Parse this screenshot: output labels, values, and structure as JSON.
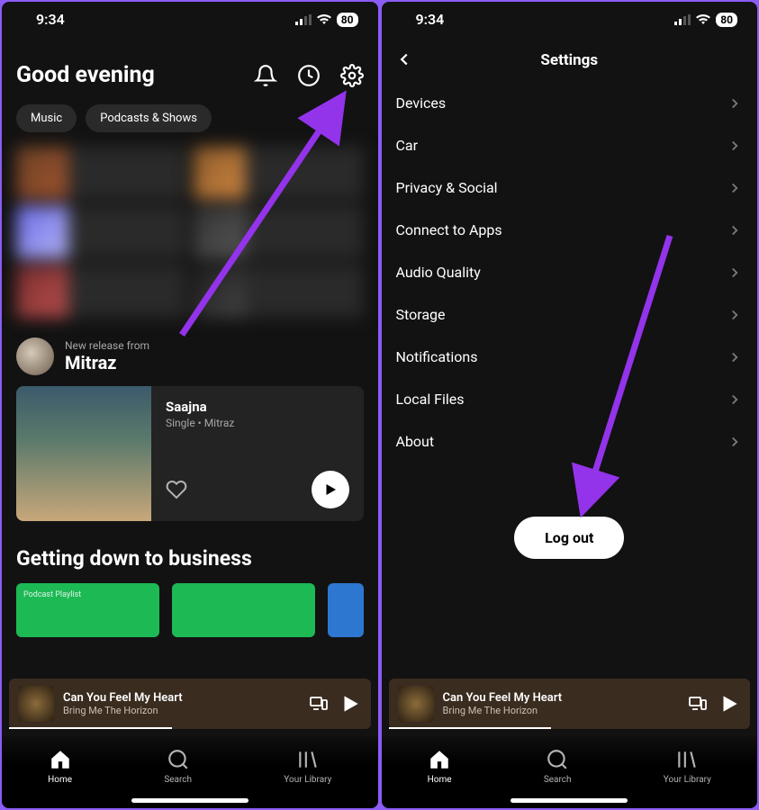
{
  "status": {
    "time": "9:34",
    "battery": "80"
  },
  "home": {
    "greeting": "Good evening",
    "chips": [
      "Music",
      "Podcasts & Shows"
    ],
    "release": {
      "label": "New release from",
      "artist": "Mitraz",
      "track": "Saajna",
      "meta": "Single • Mitraz"
    },
    "section2": "Getting down to business",
    "podcast_badge": "Podcast Playlist"
  },
  "nowplaying": {
    "title": "Can You Feel My Heart",
    "artist": "Bring Me The Horizon"
  },
  "nav": {
    "home": "Home",
    "search": "Search",
    "library": "Your Library"
  },
  "settings": {
    "title": "Settings",
    "items": [
      "Devices",
      "Car",
      "Privacy & Social",
      "Connect to Apps",
      "Audio Quality",
      "Storage",
      "Notifications",
      "Local Files",
      "About"
    ],
    "logout": "Log out"
  }
}
